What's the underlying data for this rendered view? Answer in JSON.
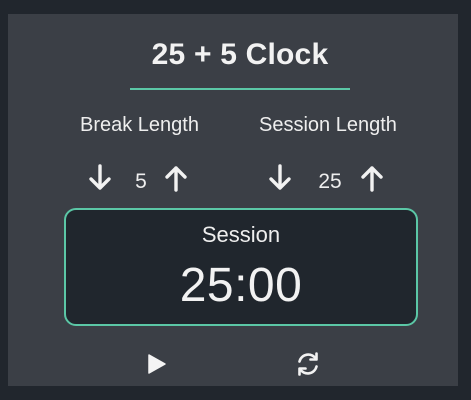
{
  "app": {
    "title": "25 + 5 Clock"
  },
  "break": {
    "label": "Break Length",
    "value": "5"
  },
  "session": {
    "label": "Session Length",
    "value": "25"
  },
  "timer": {
    "label": "Session",
    "time": "25:00"
  },
  "controls": {
    "play_icon": "play-icon",
    "reset_icon": "refresh-icon"
  },
  "colors": {
    "background": "#21262d",
    "card": "#3b3f46",
    "accent": "#5bc7a6",
    "timer_bg": "#20262d",
    "text": "#eeeeee"
  }
}
